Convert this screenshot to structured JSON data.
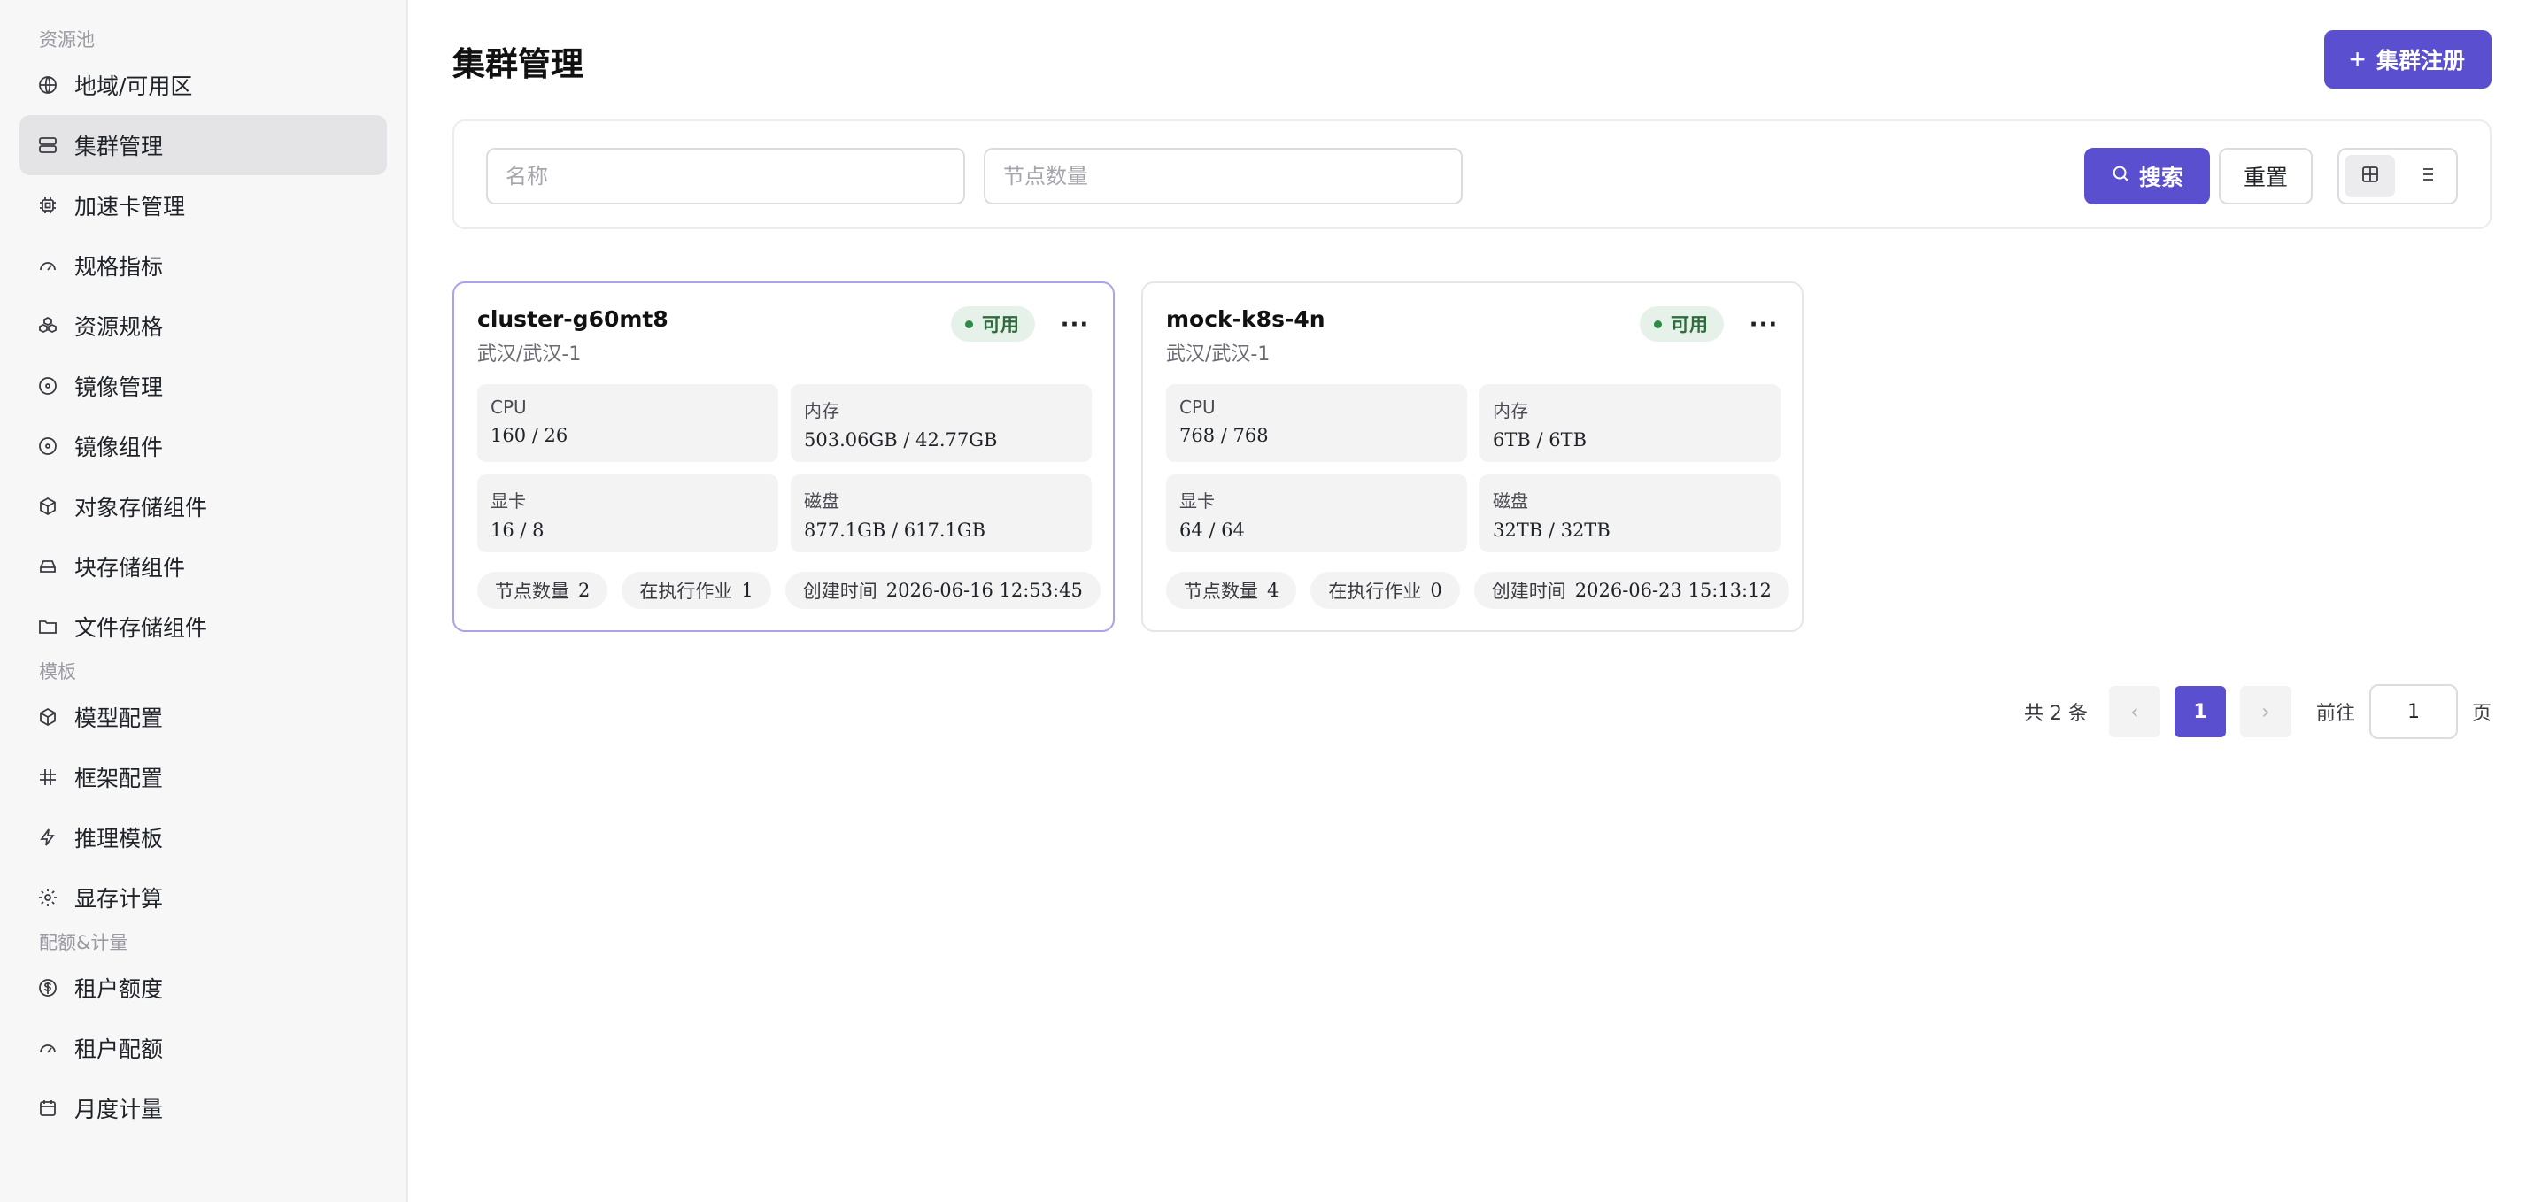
{
  "sidebar": {
    "sections": [
      {
        "title": "资源池",
        "items": [
          {
            "label": "地域/可用区",
            "icon": "globe-icon"
          },
          {
            "label": "集群管理",
            "icon": "server-icon",
            "active": true
          },
          {
            "label": "加速卡管理",
            "icon": "chip-icon"
          },
          {
            "label": "规格指标",
            "icon": "gauge-icon"
          },
          {
            "label": "资源规格",
            "icon": "boxes-icon"
          },
          {
            "label": "镜像管理",
            "icon": "disc-icon"
          },
          {
            "label": "镜像组件",
            "icon": "disc-icon"
          },
          {
            "label": "对象存储组件",
            "icon": "cube-icon"
          },
          {
            "label": "块存储组件",
            "icon": "drive-icon"
          },
          {
            "label": "文件存储组件",
            "icon": "folder-icon"
          }
        ]
      },
      {
        "title": "模板",
        "items": [
          {
            "label": "模型配置",
            "icon": "cube-icon"
          },
          {
            "label": "框架配置",
            "icon": "hash-icon"
          },
          {
            "label": "推理模板",
            "icon": "lightning-icon"
          },
          {
            "label": "显存计算",
            "icon": "gear-icon"
          }
        ]
      },
      {
        "title": "配额&计量",
        "items": [
          {
            "label": "租户额度",
            "icon": "dollar-icon"
          },
          {
            "label": "租户配额",
            "icon": "gauge-icon"
          },
          {
            "label": "月度计量",
            "icon": "calendar-icon"
          }
        ]
      }
    ]
  },
  "header": {
    "title": "集群管理",
    "register_label": "集群注册"
  },
  "filters": {
    "name_placeholder": "名称",
    "name_value": "",
    "nodes_placeholder": "节点数量",
    "nodes_value": "",
    "search_label": "搜索",
    "reset_label": "重置"
  },
  "cards": [
    {
      "name": "cluster-g60mt8",
      "region": "武汉/武汉-1",
      "status": "可用",
      "metrics": {
        "cpu_label": "CPU",
        "cpu_value": "160 / 26",
        "mem_label": "内存",
        "mem_value": "503.06GB / 42.77GB",
        "gpu_label": "显卡",
        "gpu_value": "16 / 8",
        "disk_label": "磁盘",
        "disk_value": "877.1GB / 617.1GB"
      },
      "chips": {
        "nodes_label": "节点数量",
        "nodes_value": "2",
        "jobs_label": "在执行作业",
        "jobs_value": "1",
        "created_label": "创建时间",
        "created_value": "2026-06-16 12:53:45"
      }
    },
    {
      "name": "mock-k8s-4n",
      "region": "武汉/武汉-1",
      "status": "可用",
      "metrics": {
        "cpu_label": "CPU",
        "cpu_value": "768 / 768",
        "mem_label": "内存",
        "mem_value": "6TB / 6TB",
        "gpu_label": "显卡",
        "gpu_value": "64 / 64",
        "disk_label": "磁盘",
        "disk_value": "32TB / 32TB"
      },
      "chips": {
        "nodes_label": "节点数量",
        "nodes_value": "4",
        "jobs_label": "在执行作业",
        "jobs_value": "0",
        "created_label": "创建时间",
        "created_value": "2026-06-23 15:13:12"
      }
    }
  ],
  "pagination": {
    "total": "共 2 条",
    "current_page": "1",
    "goto_label": "前往",
    "goto_value": "1",
    "page_suffix": "页"
  },
  "colors": {
    "accent": "#5a4fcf",
    "status_bg": "#e6f2e9",
    "status_text": "#2e6b3d"
  }
}
